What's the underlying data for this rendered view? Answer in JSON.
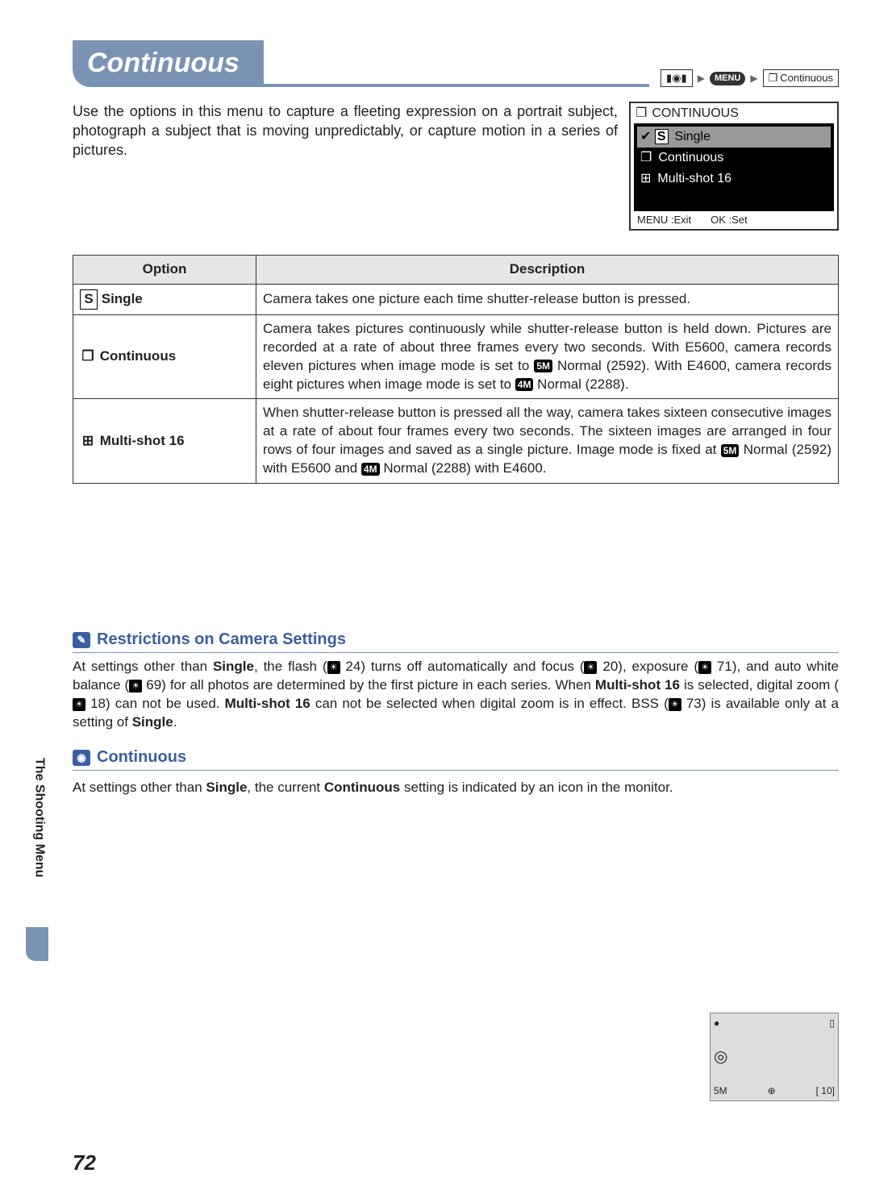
{
  "title": "Continuous",
  "breadcrumb": {
    "slot1": "",
    "menu": "MENU",
    "item_icon": "❐",
    "item": "Continuous"
  },
  "intro": "Use the options in this menu to capture a fleeting expression on a portrait subject, photograph a subject that is moving unpredictably, or capture motion in a series of pictures.",
  "lcd": {
    "heading": "CONTINUOUS",
    "items": [
      "Single",
      "Continuous",
      "Multi-shot 16"
    ],
    "foot_left": "MENU :Exit",
    "foot_right": "OK :Set"
  },
  "table": {
    "hdr_option": "Option",
    "hdr_desc": "Description",
    "rows": [
      {
        "icon": "S",
        "name": "Single",
        "desc_a": "Camera takes one picture each time shutter-release button is pressed."
      },
      {
        "icon": "❐",
        "name": "Continuous",
        "desc_a": "Camera takes pictures continuously while shutter-release button is held down. Pictures are recorded at a rate of about three frames every two seconds. With E5600, camera records eleven pictures when image mode is set to ",
        "badge1": "5M",
        "desc_b": " Normal (2592). With E4600, camera records eight pictures when image mode is set to ",
        "badge2": "4M",
        "desc_c": " Normal (2288)."
      },
      {
        "icon": "⊞",
        "name": "Multi-shot 16",
        "desc_a": "When shutter-release button is pressed all the way, camera takes sixteen consecutive images at a rate of about four frames every two seconds. The sixteen images are arranged in four rows of four images and saved as a single picture. Image mode is fixed at ",
        "badge1": "5M",
        "desc_b": " Normal (2592) with E5600 and ",
        "badge2": "4M",
        "desc_c": " Normal (2288) with E4600."
      }
    ]
  },
  "note1": {
    "heading": "Restrictions on Camera Settings",
    "p1a": "At settings other than ",
    "p1b": "Single",
    "p1c": ", the flash (",
    "r1": "24",
    "p1d": ") turns off automatically and focus (",
    "r2": "20",
    "p1e": "), exposure (",
    "r3": "71",
    "p1f": "), and auto white balance (",
    "r4": "69",
    "p1g": ") for all photos are determined by the first picture in each series. When ",
    "p1h": "Multi-shot 16",
    "p1i": " is selected, digital zoom (",
    "r5": "18",
    "p1j": ") can not be used. ",
    "p1k": "Multi-shot 16",
    "p1l": " can not be selected when digital zoom is in effect. BSS (",
    "r6": "73",
    "p1m": ") is available only at a setting of ",
    "p1n": "Single",
    "p1o": "."
  },
  "note2": {
    "heading": "Continuous",
    "text_a": "At settings other than ",
    "text_b": "Single",
    "text_c": ", the current ",
    "text_d": "Continuous",
    "text_e": " setting is indicated by an icon in the monitor."
  },
  "mini": {
    "tl": "●",
    "tr": "▯",
    "mid": "◎",
    "bl": "5M",
    "bm": "⊕",
    "br": "[  10]"
  },
  "side": "The Shooting Menu",
  "page": "72"
}
